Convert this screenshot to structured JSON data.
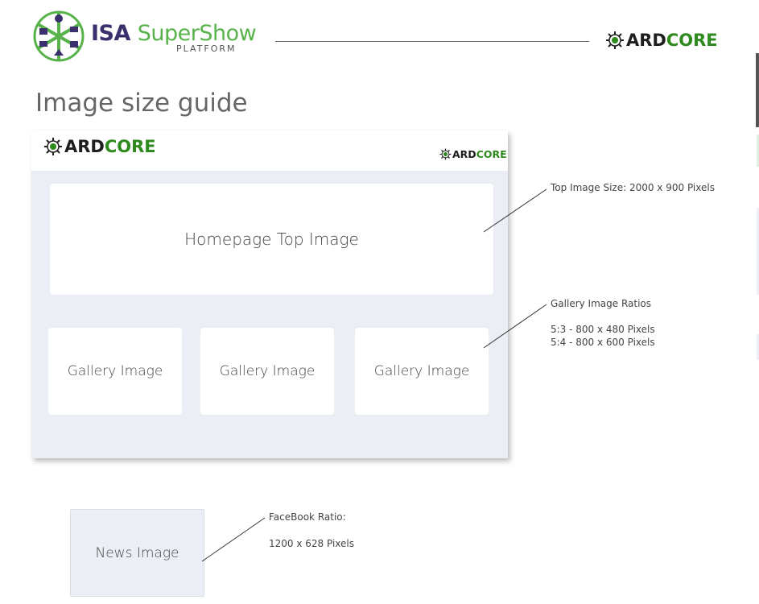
{
  "header": {
    "logo_isa": "ISA",
    "logo_supershow": "SuperShow",
    "logo_platform": "PLATFORM",
    "ardcore_left": "ARD",
    "ardcore_right": "CORE"
  },
  "page": {
    "title": "Image size guide"
  },
  "mockup": {
    "brand_left": "ARD",
    "brand_right": "CORE",
    "top_image_label": "Homepage Top Image",
    "gallery_labels": [
      "Gallery Image",
      "Gallery Image",
      "Gallery Image"
    ]
  },
  "news": {
    "label": "News Image"
  },
  "annotations": {
    "top_image": "Top Image Size: 2000 x 900 Pixels",
    "gallery_title": "Gallery Image Ratios",
    "gallery_ratio_1": "5:3 - 800 x 480 Pixels",
    "gallery_ratio_2": "5:4 - 800 x 600 Pixels",
    "facebook_title": "FaceBook Ratio:",
    "facebook_size": "1200 x 628 Pixels"
  },
  "colors": {
    "isa_purple": "#3b2f6e",
    "isa_green": "#57b24a",
    "ardcore_green": "#2f8a1e",
    "mock_background": "#ebeef5"
  }
}
